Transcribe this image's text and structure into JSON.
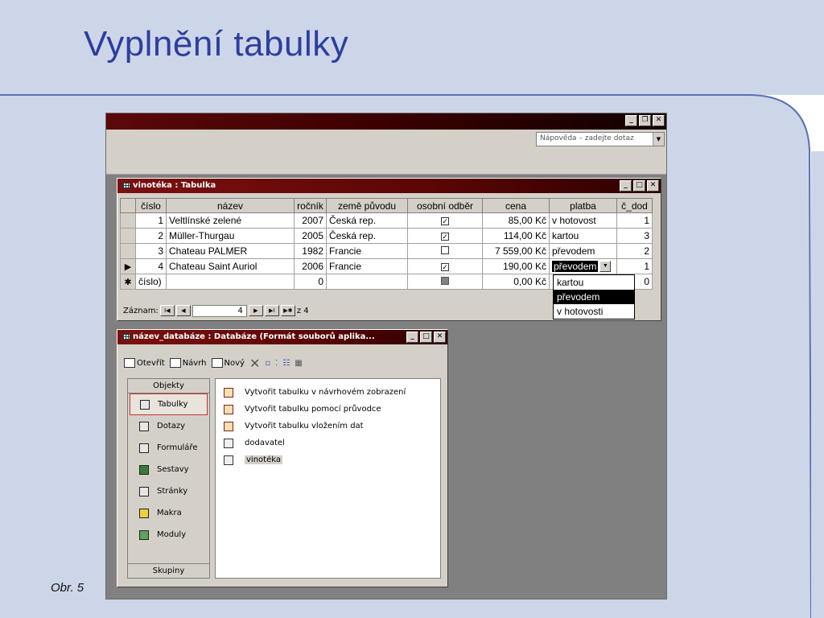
{
  "slide": {
    "title": "Vyplnění tabulky",
    "caption": "Obr. 5"
  },
  "app": {
    "help_placeholder": "Nápověda – zadejte dotaz",
    "window_buttons": [
      "_",
      "❐",
      "X"
    ]
  },
  "table_window": {
    "title": "vinotéka : Tabulka",
    "columns": [
      "číslo",
      "název",
      "ročník",
      "země původu",
      "osobní odběr",
      "cena",
      "platba",
      "č_dod"
    ],
    "rows": [
      {
        "cislo": "1",
        "nazev": "Veltlínské zelené",
        "rocnik": "2007",
        "zeme": "Česká rep.",
        "odber": true,
        "cena": "85,00 Kč",
        "platba": "v hotovost",
        "dod": "1"
      },
      {
        "cislo": "2",
        "nazev": "Müller-Thurgau",
        "rocnik": "2005",
        "zeme": "Česká rep.",
        "odber": true,
        "cena": "114,00 Kč",
        "platba": "kartou",
        "dod": "3"
      },
      {
        "cislo": "3",
        "nazev": "Chateau PALMER",
        "rocnik": "1982",
        "zeme": "Francie",
        "odber": false,
        "cena": "7 559,00 Kč",
        "platba": "převodem",
        "dod": "2"
      },
      {
        "cislo": "4",
        "nazev": "Chateau Saint Auriol",
        "rocnik": "2006",
        "zeme": "Francie",
        "odber": true,
        "cena": "190,00 Kč",
        "platba": "převodem",
        "dod": "1"
      }
    ],
    "new_row": {
      "cislo": "číslo)",
      "rocnik": "0",
      "cena": "0,00 Kč",
      "dod": "0"
    },
    "record_label": "Záznam:",
    "record_value": "4",
    "record_total": "z 4",
    "dropdown_options": [
      "kartou",
      "převodem",
      "v hotovosti"
    ],
    "dropdown_selected": "převodem"
  },
  "db_window": {
    "title": "název_databáze : Databáze (Formát souborů aplika...",
    "toolbar": {
      "open": "Otevřít",
      "design": "Návrh",
      "new": "Nový"
    },
    "objects_header": "Objekty",
    "groups_footer": "Skupiny",
    "objects": [
      "Tabulky",
      "Dotazy",
      "Formuláře",
      "Sestavy",
      "Stránky",
      "Makra",
      "Moduly"
    ],
    "active_object": "Tabulky",
    "items": [
      {
        "label": "Vytvořit tabulku v návrhovém zobrazení",
        "type": "wizard"
      },
      {
        "label": "Vytvořit tabulku pomocí průvodce",
        "type": "wizard"
      },
      {
        "label": "Vytvořit tabulku vložením dat",
        "type": "wizard"
      },
      {
        "label": "dodavatel",
        "type": "table"
      },
      {
        "label": "vinotéka",
        "type": "table"
      }
    ]
  }
}
